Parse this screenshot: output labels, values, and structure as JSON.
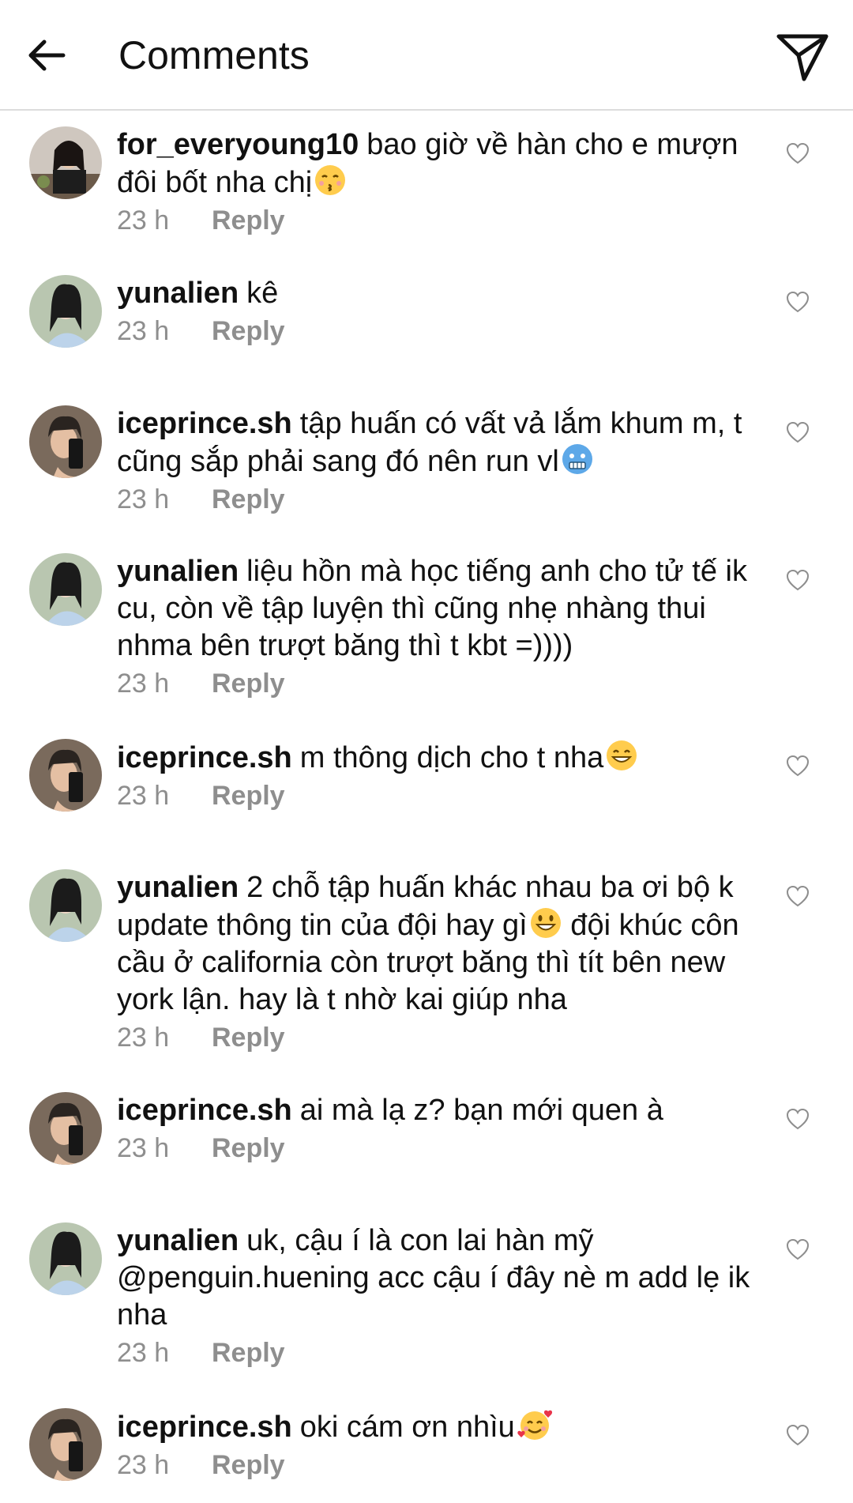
{
  "header": {
    "title": "Comments"
  },
  "comments": [
    {
      "user": "for_everyoung10",
      "text": "bao giờ về hàn cho e mượn đôi bốt nha chị",
      "emoji": "kissing-face-emoji",
      "time": "23 h",
      "reply": "Reply",
      "avatar": "for_everyoung10"
    },
    {
      "user": "yunalien",
      "text": "kê",
      "emoji": "",
      "time": "23 h",
      "reply": "Reply",
      "avatar": "yunalien"
    },
    {
      "user": "iceprince.sh",
      "text": "tập huấn có vất vả lắm khum m, t cũng sắp phải sang đó nên run vl",
      "emoji": "cold-face-emoji",
      "time": "23 h",
      "reply": "Reply",
      "avatar": "iceprince"
    },
    {
      "user": "yunalien",
      "text": "liệu hồn mà học tiếng anh cho tử tế ik cu, còn về tập luyện thì cũng nhẹ nhàng thui nhma bên trượt băng thì t kbt =))))",
      "emoji": "",
      "time": "23 h",
      "reply": "Reply",
      "avatar": "yunalien"
    },
    {
      "user": "iceprince.sh",
      "text": "m thông dịch cho t nha",
      "emoji": "grinning-face-emoji",
      "time": "23 h",
      "reply": "Reply",
      "avatar": "iceprince"
    },
    {
      "user": "yunalien",
      "text": "2 chỗ tập huấn khác nhau ba ơi bộ k update thông tin của đội hay gì",
      "emoji": "smiley-face-emoji",
      "text2": " đội khúc côn cầu ở california còn trượt băng thì tít bên new york lận. hay là t nhờ kai giúp nha",
      "time": "23 h",
      "reply": "Reply",
      "avatar": "yunalien"
    },
    {
      "user": "iceprince.sh",
      "text": "ai mà lạ z? bạn mới quen à",
      "emoji": "",
      "time": "23 h",
      "reply": "Reply",
      "avatar": "iceprince"
    },
    {
      "user": "yunalien",
      "text": "uk, cậu í là con lai hàn mỹ @penguin.huening acc cậu í đây nè m add lẹ ik nha",
      "emoji": "",
      "time": "23 h",
      "reply": "Reply",
      "avatar": "yunalien"
    },
    {
      "user": "iceprince.sh",
      "text": "oki cám ơn nhìu",
      "emoji": "smiling-face-with-hearts-emoji",
      "time": "23 h",
      "reply": "Reply",
      "avatar": "iceprince"
    }
  ],
  "colors": {
    "text": "#111111",
    "muted": "#8e8e8e",
    "divider": "#dcdcdc"
  }
}
